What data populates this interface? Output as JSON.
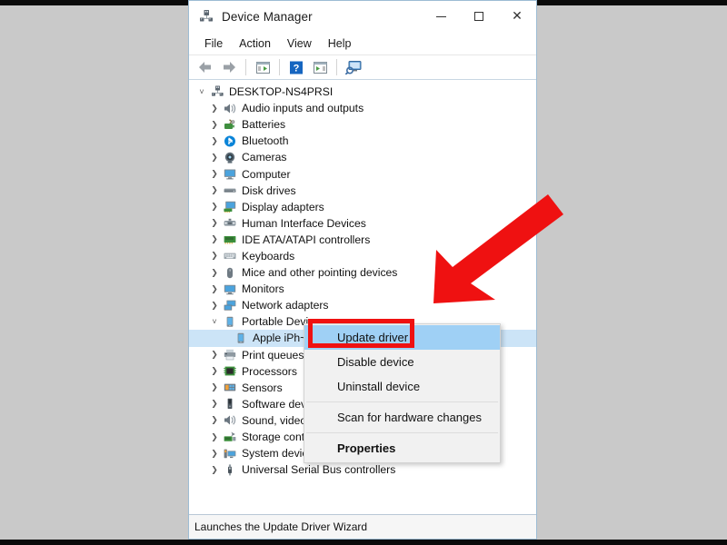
{
  "window": {
    "title": "Device Manager",
    "app_icon": "device-manager-icon",
    "controls": {
      "minimize": "─",
      "maximize": "□",
      "close": "✕"
    }
  },
  "menubar": {
    "items": [
      {
        "label": "File"
      },
      {
        "label": "Action"
      },
      {
        "label": "View"
      },
      {
        "label": "Help"
      }
    ]
  },
  "toolbar": {
    "buttons": [
      {
        "name": "back-arrow-icon",
        "tooltip": "Back"
      },
      {
        "name": "forward-arrow-icon",
        "tooltip": "Forward"
      },
      {
        "name": "show-hidden-devices-icon",
        "tooltip": "Show hidden devices"
      },
      {
        "name": "help-icon",
        "tooltip": "Help"
      },
      {
        "name": "properties-icon",
        "tooltip": "Properties"
      },
      {
        "name": "scan-hardware-icon",
        "tooltip": "Scan for hardware changes"
      }
    ]
  },
  "tree": {
    "root": {
      "label": "DESKTOP-NS4PRSI",
      "icon": "computer-root-icon",
      "expanded": true
    },
    "nodes": [
      {
        "label": "Audio inputs and outputs",
        "icon": "speaker-icon",
        "expanded": false,
        "level": 1
      },
      {
        "label": "Batteries",
        "icon": "battery-icon",
        "expanded": false,
        "level": 1
      },
      {
        "label": "Bluetooth",
        "icon": "bluetooth-icon",
        "expanded": false,
        "level": 1
      },
      {
        "label": "Cameras",
        "icon": "camera-icon",
        "expanded": false,
        "level": 1
      },
      {
        "label": "Computer",
        "icon": "monitor-icon",
        "expanded": false,
        "level": 1
      },
      {
        "label": "Disk drives",
        "icon": "disk-drive-icon",
        "expanded": false,
        "level": 1
      },
      {
        "label": "Display adapters",
        "icon": "display-adapter-icon",
        "expanded": false,
        "level": 1
      },
      {
        "label": "Human Interface Devices",
        "icon": "hid-icon",
        "expanded": false,
        "level": 1
      },
      {
        "label": "IDE ATA/ATAPI controllers",
        "icon": "ide-controller-icon",
        "expanded": false,
        "level": 1
      },
      {
        "label": "Keyboards",
        "icon": "keyboard-icon",
        "expanded": false,
        "level": 1
      },
      {
        "label": "Mice and other pointing devices",
        "icon": "mouse-icon",
        "expanded": false,
        "level": 1
      },
      {
        "label": "Monitors",
        "icon": "monitor-icon",
        "expanded": false,
        "level": 1
      },
      {
        "label": "Network adapters",
        "icon": "network-adapter-icon",
        "expanded": false,
        "level": 1
      },
      {
        "label": "Portable Devices",
        "icon": "portable-device-icon",
        "expanded": true,
        "level": 1
      },
      {
        "label": "Apple iPh~~",
        "icon": "portable-device-icon",
        "expanded": null,
        "level": 2,
        "selected": true
      },
      {
        "label": "Print queues",
        "icon": "printer-icon",
        "expanded": false,
        "level": 1
      },
      {
        "label": "Processors",
        "icon": "processor-icon",
        "expanded": false,
        "level": 1
      },
      {
        "label": "Sensors",
        "icon": "sensor-icon",
        "expanded": false,
        "level": 1
      },
      {
        "label": "Software dev",
        "icon": "software-device-icon",
        "expanded": false,
        "level": 1
      },
      {
        "label": "Sound, video",
        "icon": "speaker-icon",
        "expanded": false,
        "level": 1
      },
      {
        "label": "Storage cont",
        "icon": "storage-controller-icon",
        "expanded": false,
        "level": 1
      },
      {
        "label": "System devic",
        "icon": "system-device-icon",
        "expanded": false,
        "level": 1
      },
      {
        "label": "Universal Serial Bus controllers",
        "icon": "usb-icon",
        "expanded": false,
        "level": 1
      }
    ]
  },
  "context_menu": {
    "items": [
      {
        "label": "Update driver",
        "highlighted": true,
        "bold": false
      },
      {
        "label": "Disable device",
        "highlighted": false,
        "bold": false
      },
      {
        "label": "Uninstall device",
        "highlighted": false,
        "bold": false
      },
      {
        "separator": true
      },
      {
        "label": "Scan for hardware changes",
        "highlighted": false,
        "bold": false
      },
      {
        "separator": true
      },
      {
        "label": "Properties",
        "highlighted": false,
        "bold": true
      }
    ]
  },
  "annotation": {
    "arrow": "red-arrow-pointing-down-left",
    "highlight_box": "red-rectangle-around-update-driver",
    "color": "#ef1111"
  },
  "statusbar": {
    "text": "Launches the Update Driver Wizard"
  },
  "colors": {
    "selection_blue": "#cce4f7",
    "menu_highlight": "#9fd0f5",
    "annotation_red": "#ef1111",
    "page_background": "#c9c9c9"
  }
}
